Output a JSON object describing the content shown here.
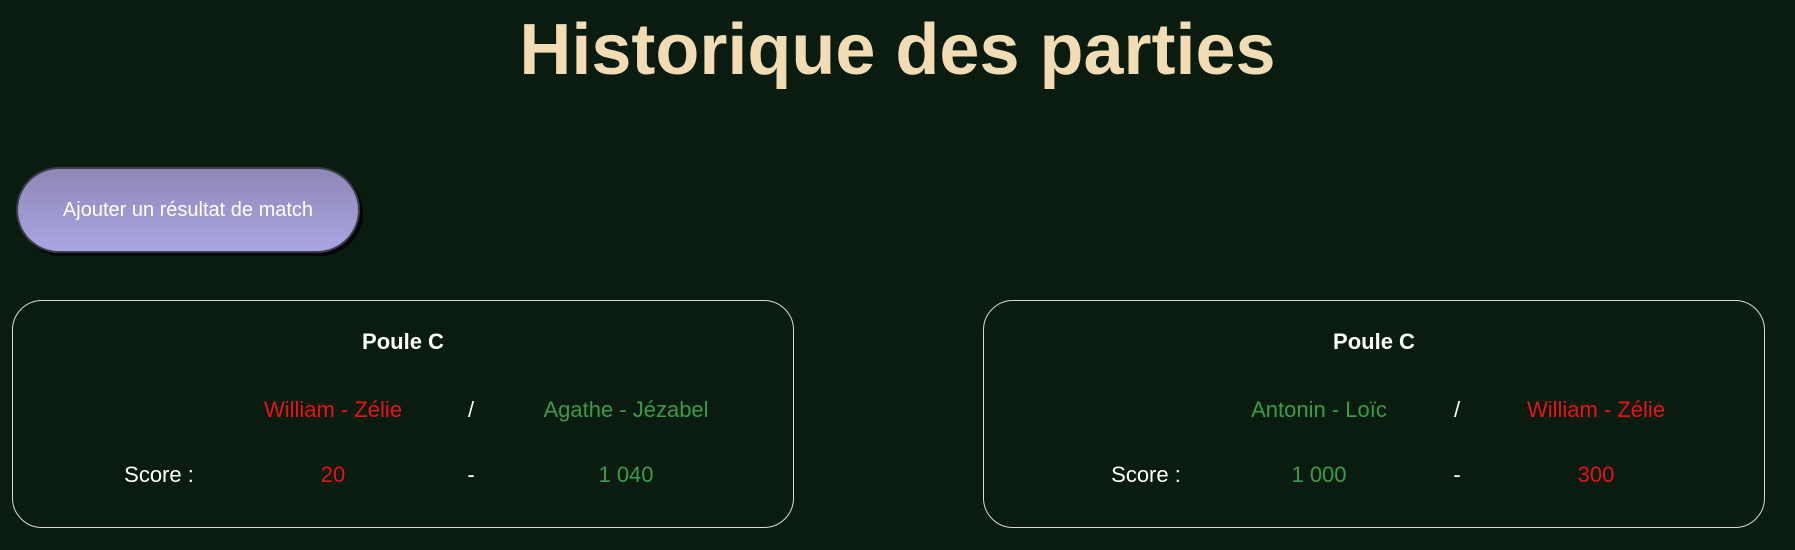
{
  "page": {
    "title": "Historique des parties"
  },
  "actions": {
    "add_result_label": "Ajouter un résultat de match"
  },
  "colors": {
    "background": "#0a1b10",
    "title": "#f1dcb3",
    "winner": "#3a9d46",
    "loser": "#e81313",
    "button_top": "#8f87b5",
    "button_bottom": "#a9a6e4"
  },
  "matches": [
    {
      "pool": "Poule C",
      "team1": "William - Zélie",
      "separator": "/",
      "team2": "Agathe - Jézabel",
      "score_label": "Score :",
      "score1": "20",
      "score_separator": "-",
      "score2": "1 040"
    },
    {
      "pool": "Poule C",
      "team1": "Antonin - Loïc",
      "separator": "/",
      "team2": "William - Zélie",
      "score_label": "Score :",
      "score1": "1 000",
      "score_separator": "-",
      "score2": "300"
    }
  ]
}
